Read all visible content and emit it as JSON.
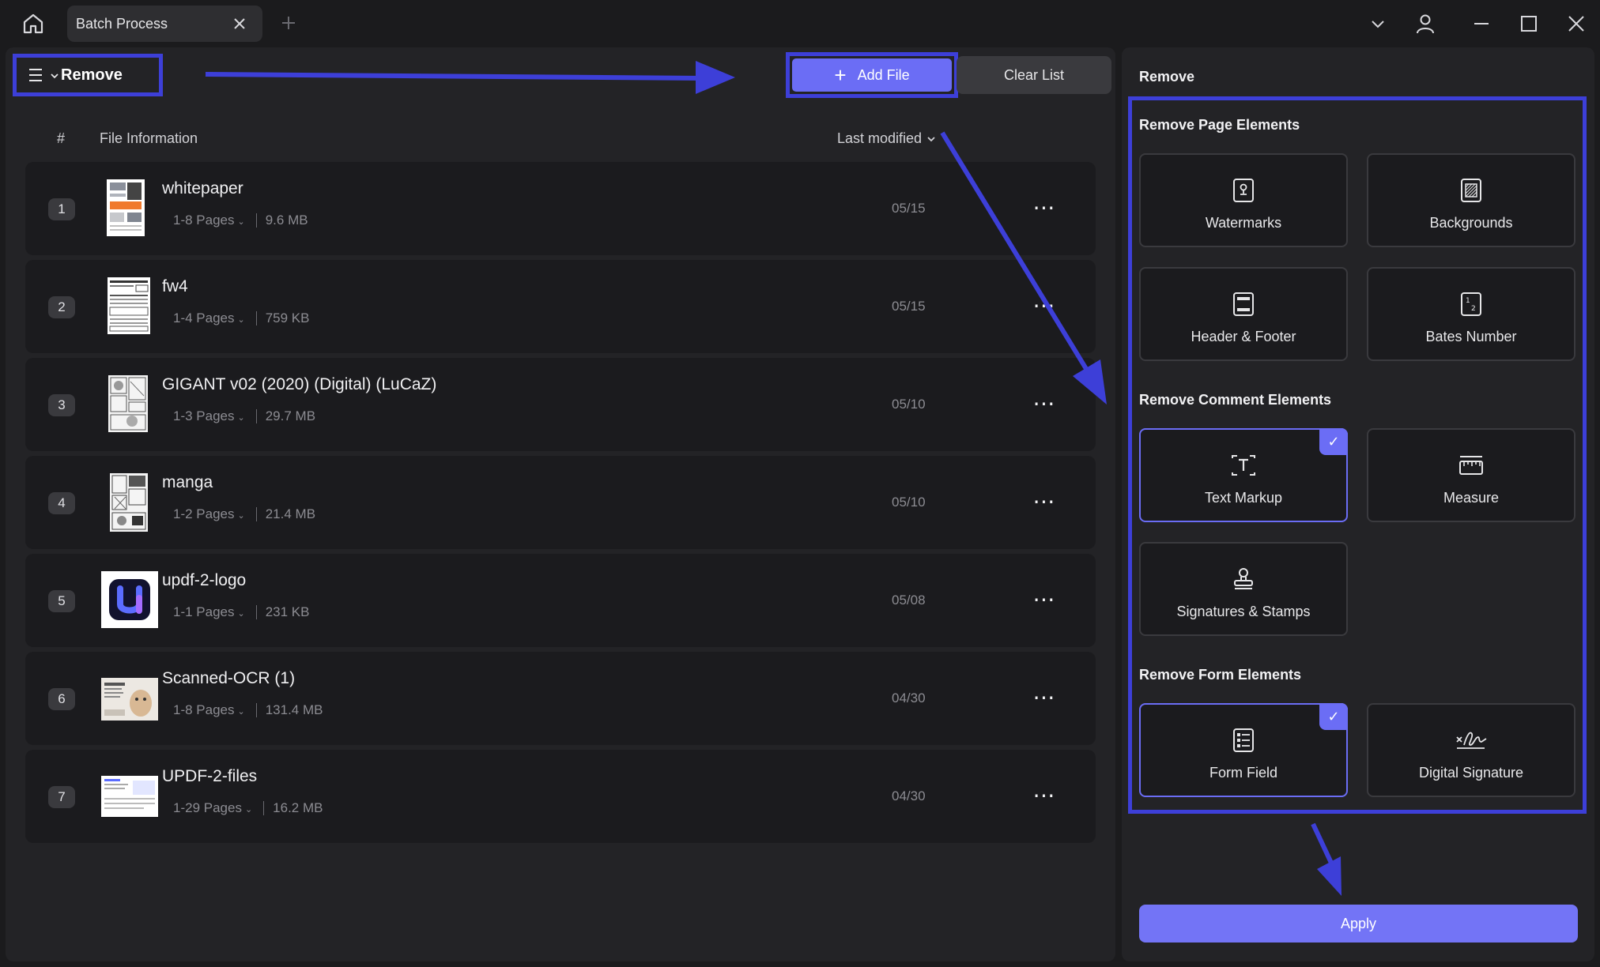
{
  "tab": {
    "title": "Batch Process"
  },
  "toolbar": {
    "mode_label": "Remove",
    "add_file_label": "Add File",
    "clear_list_label": "Clear List"
  },
  "columns": {
    "number": "#",
    "file_info": "File Information",
    "last_modified": "Last modified"
  },
  "files": [
    {
      "num": "1",
      "name": "whitepaper",
      "pages": "1-8 Pages",
      "size": "9.6 MB",
      "date": "05/15"
    },
    {
      "num": "2",
      "name": "fw4",
      "pages": "1-4 Pages",
      "size": "759 KB",
      "date": "05/15"
    },
    {
      "num": "3",
      "name": "GIGANT v02 (2020) (Digital) (LuCaZ)",
      "pages": "1-3 Pages",
      "size": "29.7 MB",
      "date": "05/10"
    },
    {
      "num": "4",
      "name": "manga",
      "pages": "1-2 Pages",
      "size": "21.4 MB",
      "date": "05/10"
    },
    {
      "num": "5",
      "name": "updf-2-logo",
      "pages": "1-1 Pages",
      "size": "231 KB",
      "date": "05/08"
    },
    {
      "num": "6",
      "name": "Scanned-OCR (1)",
      "pages": "1-8 Pages",
      "size": "131.4 MB",
      "date": "04/30"
    },
    {
      "num": "7",
      "name": "UPDF-2-files",
      "pages": "1-29 Pages",
      "size": "16.2 MB",
      "date": "04/30"
    }
  ],
  "panel": {
    "title": "Remove",
    "sections": {
      "page": "Remove Page Elements",
      "comment": "Remove Comment Elements",
      "form": "Remove Form Elements"
    },
    "options": {
      "watermarks": "Watermarks",
      "backgrounds": "Backgrounds",
      "header_footer": "Header & Footer",
      "bates_number": "Bates Number",
      "text_markup": "Text Markup",
      "measure": "Measure",
      "signatures_stamps": "Signatures & Stamps",
      "form_field": "Form Field",
      "digital_signature": "Digital Signature"
    },
    "selected": [
      "text_markup",
      "form_field"
    ],
    "apply_label": "Apply"
  },
  "colors": {
    "accent": "#6b6df5",
    "annotation": "#3d3fd8",
    "background": "#1b1b1d",
    "panel": "#232326"
  }
}
